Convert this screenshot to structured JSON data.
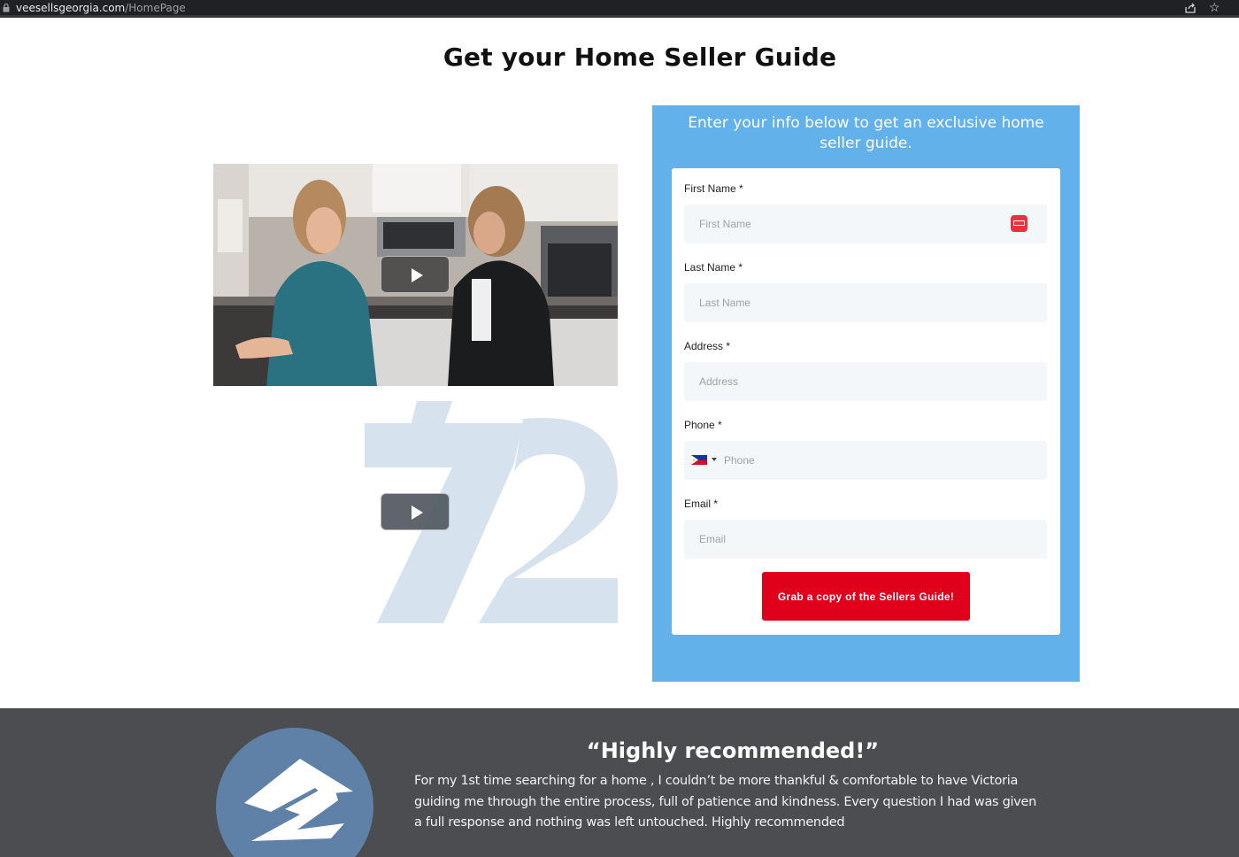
{
  "browser": {
    "url_host": "veesellsgeorgia.com",
    "url_path": "/HomePage"
  },
  "page": {
    "title": "Get your Home Seller Guide"
  },
  "form": {
    "heading": "Enter your info below to get an exclusive home seller guide.",
    "fields": [
      {
        "label": "First Name *",
        "placeholder": "First Name",
        "value": ""
      },
      {
        "label": "Last Name *",
        "placeholder": "Last Name",
        "value": ""
      },
      {
        "label": "Address *",
        "placeholder": "Address",
        "value": ""
      },
      {
        "label": "Phone *",
        "placeholder": "Phone",
        "value": "",
        "country": "Philippines"
      },
      {
        "label": "Email *",
        "placeholder": "Email",
        "value": ""
      }
    ],
    "submit_label": "Grab a copy of the Sellers Guide!",
    "panel_color": "#62b1ea",
    "button_color": "#e0001b"
  },
  "videos": [
    {
      "thumbnail": "two women in kitchen"
    },
    {
      "thumbnail": "72 logo"
    }
  ],
  "testimonial": {
    "title": "“Highly recommended!”",
    "body": "For my 1st time searching for a home , I couldn’t be more thankful & comfortable to have Victoria guiding me through the entire process, full of patience and kindness. Every question I had was given a full response and nothing was left untouched. Highly recommended",
    "logo": "zillow-icon",
    "background_color": "#4c4d50"
  }
}
